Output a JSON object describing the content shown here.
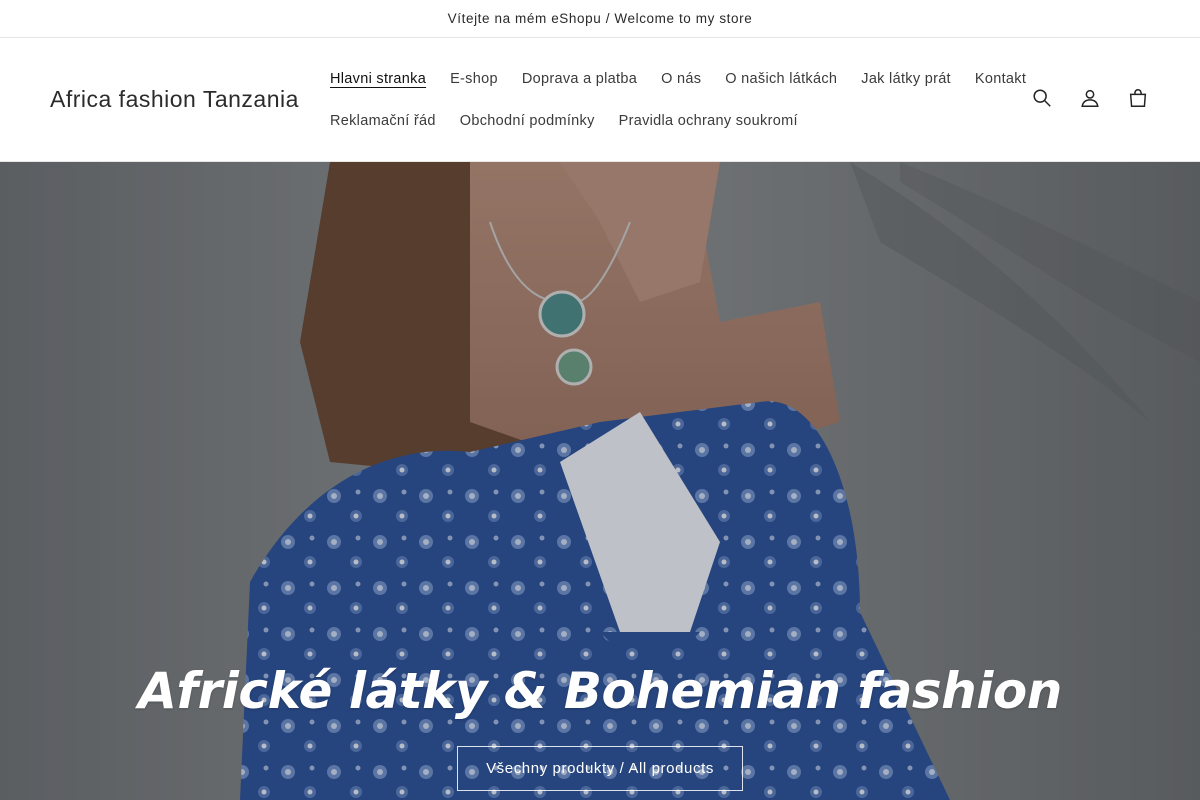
{
  "announcement": {
    "text": "Vítejte na mém eShopu / Welcome to my store"
  },
  "header": {
    "logo": "Africa fashion Tanzania",
    "nav_row1": [
      {
        "label": "Hlavni stranka",
        "active": true
      },
      {
        "label": "E-shop"
      },
      {
        "label": "Doprava a platba"
      },
      {
        "label": "O nás"
      },
      {
        "label": "O našich látkách"
      },
      {
        "label": "Jak látky prát"
      },
      {
        "label": "Kontakt"
      }
    ],
    "nav_row2": [
      {
        "label": "Reklamační řád"
      },
      {
        "label": "Obchodní podmínky"
      },
      {
        "label": "Pravidla ochrany soukromí"
      }
    ],
    "icons": [
      "search-icon",
      "account-icon",
      "cart-icon"
    ]
  },
  "hero": {
    "title": "Africké látky & Bohemian fashion",
    "button_label": "Všechny produkty / All products"
  },
  "colors": {
    "text": "#121212",
    "border": "#e6e6e6",
    "dress_blue": "#2f5499",
    "background": "#ffffff"
  }
}
